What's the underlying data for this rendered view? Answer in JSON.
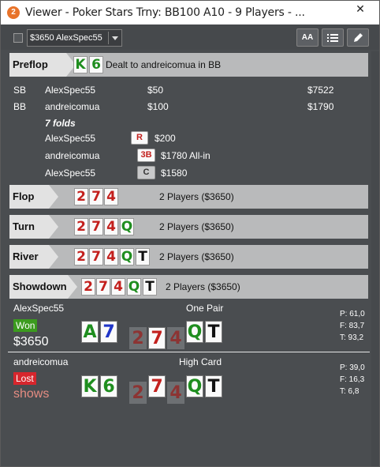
{
  "window": {
    "title": "Viewer - Poker Stars Trny: BB100 A10 - 9 Players - ...",
    "app_icon": "2",
    "close_symbol": "✕"
  },
  "toolbar": {
    "player_select_value": "$3650 AlexSpec55",
    "font_button_label": "AA"
  },
  "preflop": {
    "label": "Preflop",
    "hero_cards": [
      {
        "rank": "K",
        "suit": "c"
      },
      {
        "rank": "6",
        "suit": "c"
      }
    ],
    "dealt_text": "Dealt to andreicomua in BB",
    "blinds": [
      {
        "position": "SB",
        "player": "AlexSpec55",
        "amount": "$50",
        "stack": "$7522"
      },
      {
        "position": "BB",
        "player": "andreicomua",
        "amount": "$100",
        "stack": "$1790"
      }
    ],
    "folds_text": "7 folds",
    "actions": [
      {
        "player": "AlexSpec55",
        "badge": "R",
        "amount": "$200"
      },
      {
        "player": "andreicomua",
        "badge": "3B",
        "amount": "$1780 All-in"
      },
      {
        "player": "AlexSpec55",
        "badge": "C",
        "amount": "$1580"
      }
    ]
  },
  "streets": [
    {
      "label": "Flop",
      "cards": [
        {
          "rank": "2",
          "suit": "h"
        },
        {
          "rank": "7",
          "suit": "h"
        },
        {
          "rank": "4",
          "suit": "h"
        }
      ],
      "info": "2 Players ($3650)"
    },
    {
      "label": "Turn",
      "cards": [
        {
          "rank": "2",
          "suit": "h"
        },
        {
          "rank": "7",
          "suit": "h"
        },
        {
          "rank": "4",
          "suit": "h"
        },
        {
          "rank": "Q",
          "suit": "c"
        }
      ],
      "info": "2 Players ($3650)"
    },
    {
      "label": "River",
      "cards": [
        {
          "rank": "2",
          "suit": "h"
        },
        {
          "rank": "7",
          "suit": "h"
        },
        {
          "rank": "4",
          "suit": "h"
        },
        {
          "rank": "Q",
          "suit": "c"
        },
        {
          "rank": "T",
          "suit": "s"
        }
      ],
      "info": "2 Players ($3650)"
    },
    {
      "label": "Showdown",
      "cards": [
        {
          "rank": "2",
          "suit": "h"
        },
        {
          "rank": "7",
          "suit": "h"
        },
        {
          "rank": "4",
          "suit": "h"
        },
        {
          "rank": "Q",
          "suit": "c"
        },
        {
          "rank": "T",
          "suit": "s"
        }
      ],
      "info": "2 Players ($3650)"
    }
  ],
  "showdown": [
    {
      "player": "AlexSpec55",
      "hand_name": "One Pair",
      "result": "Won",
      "result_detail": "$3650",
      "hole_cards": [
        {
          "rank": "A",
          "suit": "c"
        },
        {
          "rank": "7",
          "suit": "d"
        }
      ],
      "board_cards": [
        {
          "rank": "2",
          "suit": "h"
        },
        {
          "rank": "7",
          "suit": "h"
        },
        {
          "rank": "4",
          "suit": "h"
        },
        {
          "rank": "Q",
          "suit": "c"
        },
        {
          "rank": "T",
          "suit": "s"
        }
      ],
      "stats": [
        "P: 61,0",
        "F: 83,7",
        "T: 93,2"
      ]
    },
    {
      "player": "andreicomua",
      "hand_name": "High Card",
      "result": "Lost",
      "result_detail": "shows",
      "hole_cards": [
        {
          "rank": "K",
          "suit": "c"
        },
        {
          "rank": "6",
          "suit": "c"
        }
      ],
      "board_cards": [
        {
          "rank": "2",
          "suit": "h"
        },
        {
          "rank": "7",
          "suit": "h"
        },
        {
          "rank": "4",
          "suit": "h"
        },
        {
          "rank": "Q",
          "suit": "c"
        },
        {
          "rank": "T",
          "suit": "s"
        }
      ],
      "stats": [
        "P: 39,0",
        "F: 16,3",
        "T:   6,8"
      ]
    }
  ],
  "colors": {
    "background": "#4a4d50",
    "street_bar": "#b9babb",
    "won": "#3b9b1e",
    "lost": "#d7262d",
    "hearts": "#c3201d",
    "clubs": "#1f8e1f",
    "diamonds": "#2035c8"
  },
  "icons": [
    "close-icon",
    "chevron-down-icon",
    "font-size-icon",
    "list-icon",
    "edit-icon"
  ]
}
